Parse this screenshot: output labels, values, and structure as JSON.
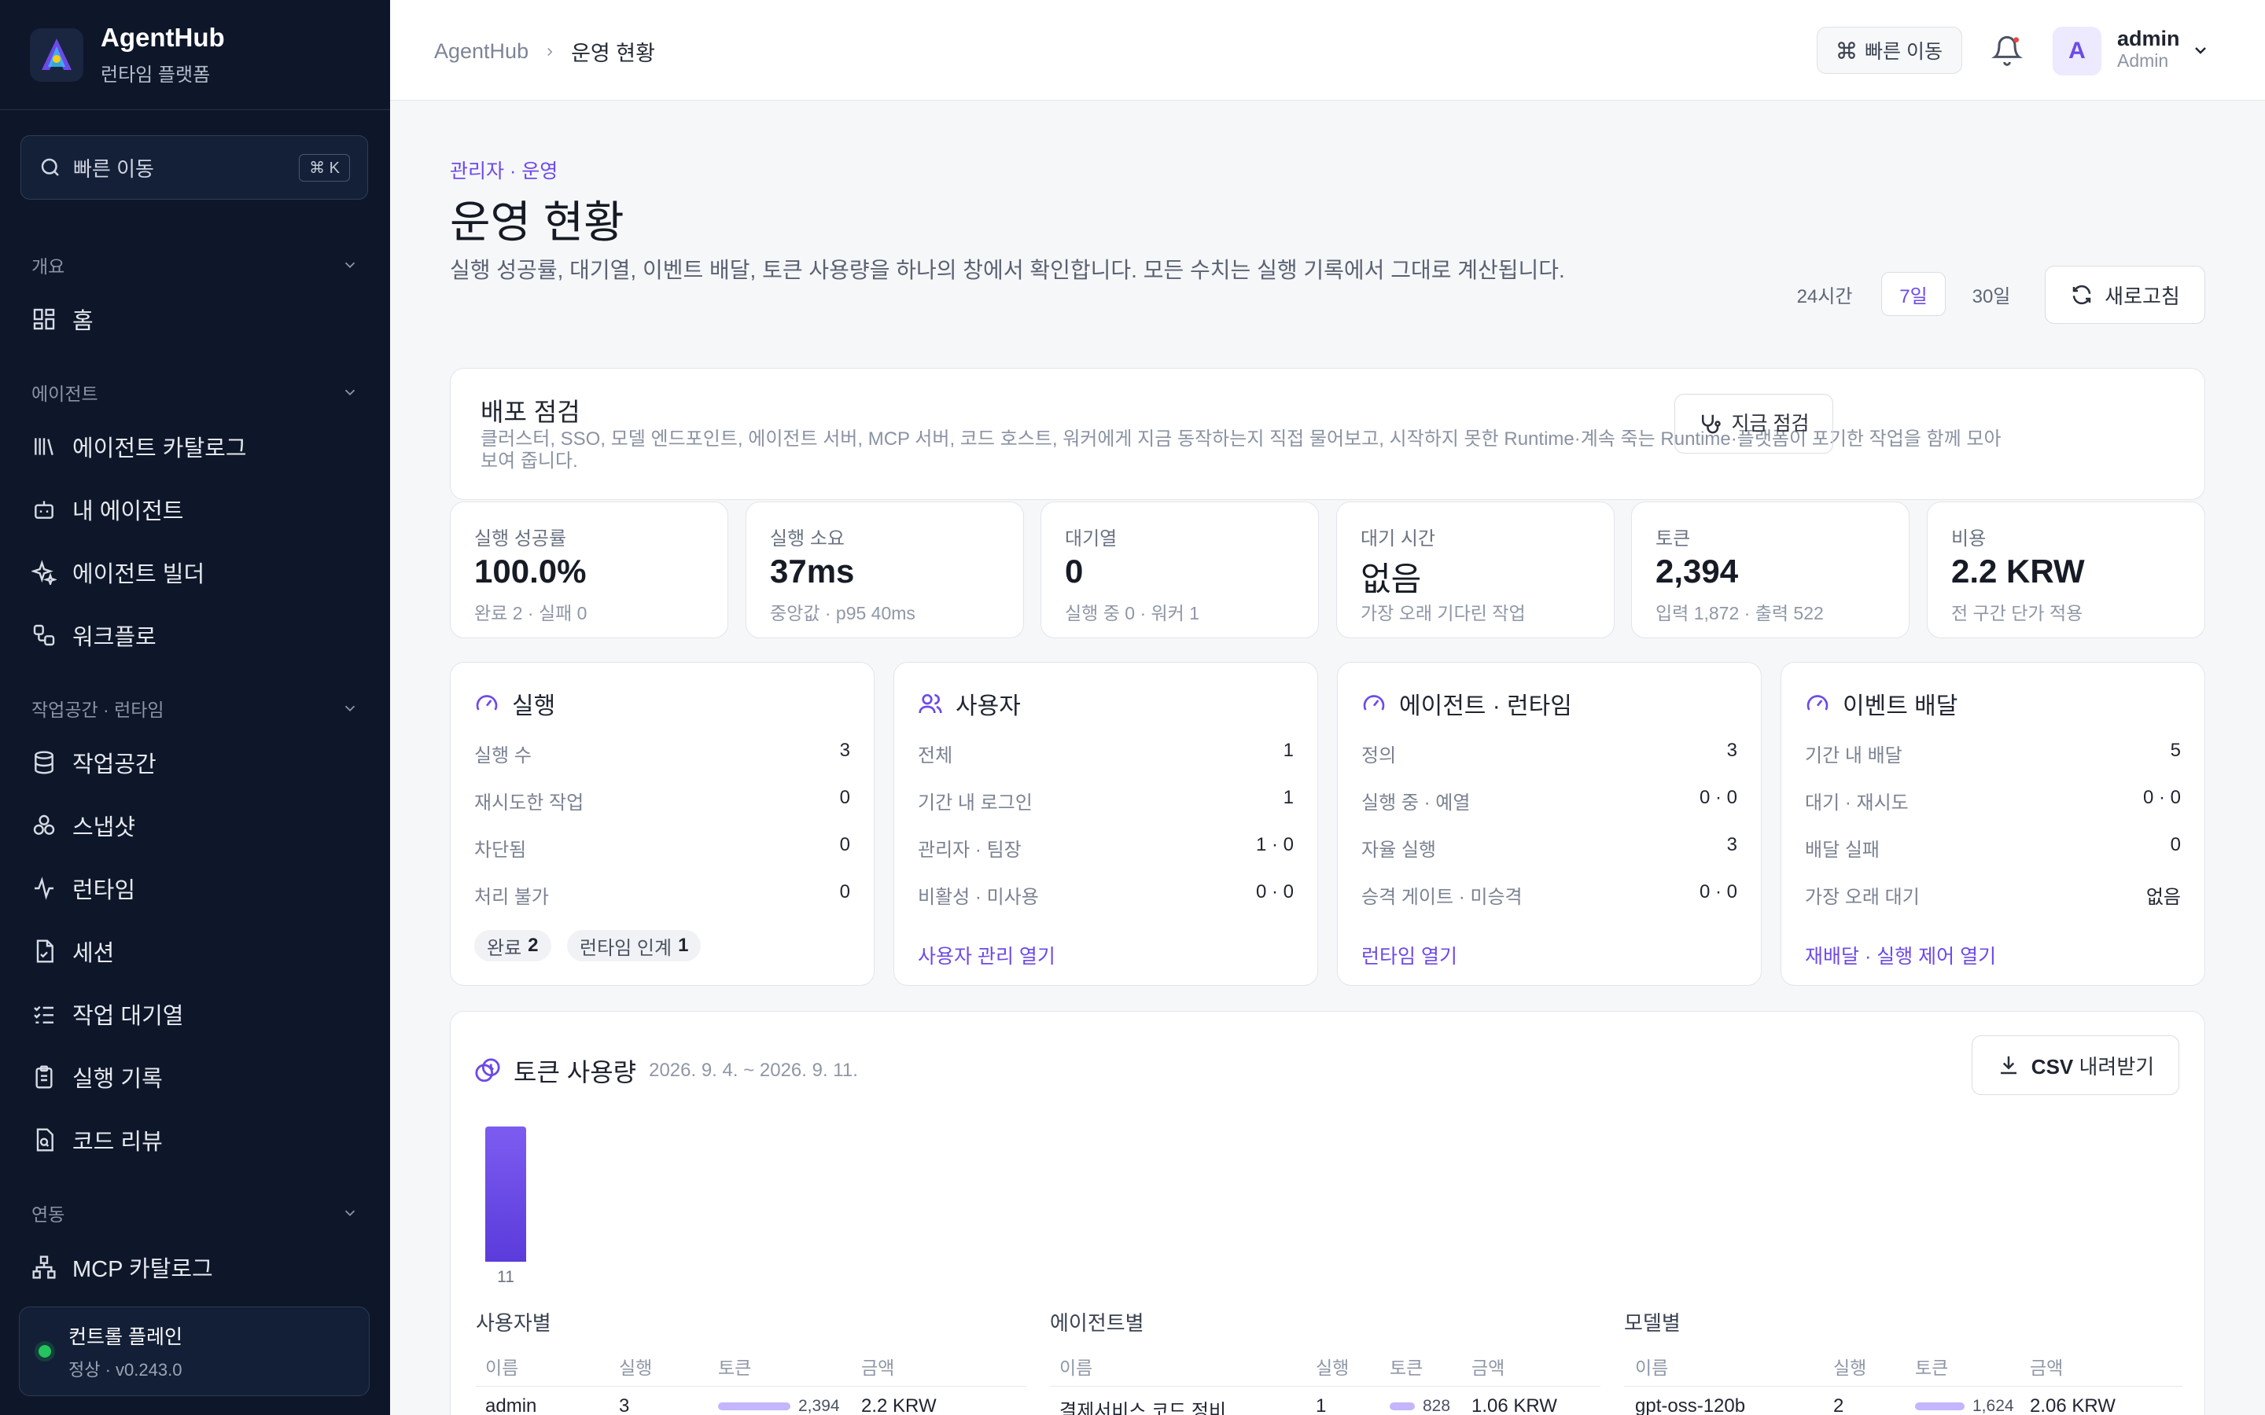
{
  "app": {
    "name": "AgentHub",
    "subtitle": "런타임 플랫폼"
  },
  "sidebar": {
    "search_placeholder": "빠른 이동",
    "search_shortcut": "⌘ K",
    "groups": [
      {
        "label": "개요",
        "items": [
          {
            "label": "홈",
            "icon": "home-icon"
          }
        ]
      },
      {
        "label": "에이전트",
        "items": [
          {
            "label": "에이전트 카탈로그",
            "icon": "library-icon"
          },
          {
            "label": "내 에이전트",
            "icon": "bot-icon"
          },
          {
            "label": "에이전트 빌더",
            "icon": "sparkles-icon"
          },
          {
            "label": "워크플로",
            "icon": "workflow-icon"
          }
        ]
      },
      {
        "label": "작업공간 · 런타임",
        "items": [
          {
            "label": "작업공간",
            "icon": "database-icon"
          },
          {
            "label": "스냅샷",
            "icon": "snapshot-icon"
          },
          {
            "label": "런타임",
            "icon": "activity-icon"
          },
          {
            "label": "세션",
            "icon": "file-session-icon"
          },
          {
            "label": "작업 대기열",
            "icon": "list-check-icon"
          },
          {
            "label": "실행 기록",
            "icon": "clipboard-icon"
          },
          {
            "label": "코드 리뷰",
            "icon": "file-search-icon"
          }
        ]
      },
      {
        "label": "연동",
        "items": [
          {
            "label": "MCP 카탈로그",
            "icon": "network-icon"
          }
        ]
      }
    ],
    "control_plane": {
      "title": "컨트롤 플레인",
      "status": "정상 · v0.243.0",
      "status_color": "#22c55e"
    }
  },
  "header": {
    "breadcrumb": [
      "AgentHub",
      "운영 현황"
    ],
    "quick_label": "빠른 이동",
    "user": {
      "initial": "A",
      "name": "admin",
      "role": "Admin"
    }
  },
  "page": {
    "eyebrow": "관리자 · 운영",
    "title": "운영 현황",
    "description": "실행 성공률, 대기열, 이벤트 배달, 토큰 사용량을 하나의 창에서 확인합니다. 모든 수치는 실행 기록에서 그대로 계산됩니다.",
    "ranges": [
      "24시간",
      "7일",
      "30일"
    ],
    "active_range": "7일",
    "refresh_label": "새로고침"
  },
  "deploy": {
    "title": "배포 점검",
    "description": "클러스터, SSO, 모델 엔드포인트, 에이전트 서버, MCP 서버, 코드 호스트, 워커에게 지금 동작하는지 직접 물어보고, 시작하지 못한 Runtime·계속 죽는 Runtime·플랫폼이 포기한 작업을 함께 모아 보여 줍니다.",
    "button": "지금 점검"
  },
  "metrics": [
    {
      "label": "실행 성공률",
      "value": "100.0%",
      "sub": "완료 2 · 실패 0"
    },
    {
      "label": "실행 소요",
      "value": "37ms",
      "sub": "중앙값 · p95 40ms"
    },
    {
      "label": "대기열",
      "value": "0",
      "sub": "실행 중 0 · 워커 1"
    },
    {
      "label": "대기 시간",
      "value": "없음",
      "sub": "가장 오래 기다린 작업"
    },
    {
      "label": "토큰",
      "value": "2,394",
      "sub": "입력 1,872 · 출력 522"
    },
    {
      "label": "비용",
      "value": "2.2 KRW",
      "sub": "전 구간 단가 적용"
    }
  ],
  "panels": {
    "runs": {
      "title": "실행",
      "rows": [
        [
          "실행 수",
          "3"
        ],
        [
          "재시도한 작업",
          "0"
        ],
        [
          "차단됨",
          "0"
        ],
        [
          "처리 불가",
          "0"
        ]
      ],
      "chips": [
        {
          "label": "완료",
          "value": "2"
        },
        {
          "label": "런타임 인계",
          "value": "1"
        }
      ]
    },
    "users": {
      "title": "사용자",
      "rows": [
        [
          "전체",
          "1"
        ],
        [
          "기간 내 로그인",
          "1"
        ],
        [
          "관리자 · 팀장",
          "1 · 0"
        ],
        [
          "비활성 · 미사용",
          "0 · 0"
        ]
      ],
      "link": "사용자 관리 열기"
    },
    "agents": {
      "title": "에이전트 · 런타임",
      "rows": [
        [
          "정의",
          "3"
        ],
        [
          "실행 중 · 예열",
          "0 · 0"
        ],
        [
          "자율 실행",
          "3"
        ],
        [
          "승격 게이트 · 미승격",
          "0 · 0"
        ]
      ],
      "link": "런타임 열기"
    },
    "events": {
      "title": "이벤트 배달",
      "rows": [
        [
          "기간 내 배달",
          "5"
        ],
        [
          "대기 · 재시도",
          "0 · 0"
        ],
        [
          "배달 실패",
          "0"
        ],
        [
          "가장 오래 대기",
          "없음"
        ]
      ],
      "link": "재배달 · 실행 제어 열기"
    }
  },
  "tokens": {
    "title": "토큰 사용량",
    "date_range": "2026. 9. 4. ~ 2026. 9. 11.",
    "csv_bold": "CSV",
    "csv_rest": "내려받기",
    "chart_data": {
      "type": "bar",
      "categories": [
        "11"
      ],
      "values": [
        2394
      ],
      "title": "",
      "xlabel": "",
      "ylabel": ""
    },
    "tables": [
      {
        "title": "사용자별",
        "headers": [
          "이름",
          "실행",
          "토큰",
          "금액"
        ],
        "rows": [
          {
            "name": "admin",
            "runs": "3",
            "tokens": "2,394",
            "amount": "2.2 KRW",
            "share": 1.0
          }
        ]
      },
      {
        "title": "에이전트별",
        "headers": [
          "이름",
          "실행",
          "토큰",
          "금액"
        ],
        "rows": [
          {
            "name": "결제서비스 코드 정비",
            "runs": "1",
            "tokens": "828",
            "amount": "1.06 KRW",
            "share": 0.35
          }
        ]
      },
      {
        "title": "모델별",
        "headers": [
          "이름",
          "실행",
          "토큰",
          "금액"
        ],
        "rows": [
          {
            "name": "gpt-oss-120b",
            "runs": "2",
            "tokens": "1,624",
            "amount": "2.06 KRW",
            "share": 0.68
          }
        ]
      }
    ]
  }
}
